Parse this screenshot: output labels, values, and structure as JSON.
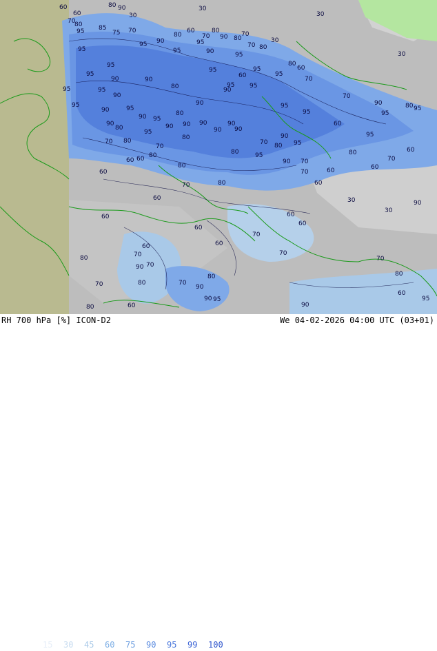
{
  "footer": {
    "left_label": "RH 700 hPa [%] ICON-D2",
    "right_label": "We 04-02-2026 04:00 UTC (03+01)"
  },
  "legend": {
    "values": [
      {
        "label": "15",
        "color": "#e6eef8"
      },
      {
        "label": "30",
        "color": "#c8dcf0"
      },
      {
        "label": "45",
        "color": "#a9c9e8"
      },
      {
        "label": "60",
        "color": "#7fb0e6"
      },
      {
        "label": "75",
        "color": "#6c9ee0"
      },
      {
        "label": "90",
        "color": "#5a8be0"
      },
      {
        "label": "95",
        "color": "#4a78dc"
      },
      {
        "label": "99",
        "color": "#3e66d6"
      },
      {
        "label": "100",
        "color": "#2f55cc"
      }
    ]
  },
  "map": {
    "contour_labels": [
      "60",
      "60",
      "80",
      "90",
      "30",
      "30",
      "30",
      "70",
      "80",
      "95",
      "85",
      "75",
      "70",
      "80",
      "60",
      "70",
      "80",
      "90",
      "80",
      "70",
      "30",
      "95",
      "90",
      "95",
      "95",
      "70",
      "80",
      "30",
      "95",
      "90",
      "95",
      "95",
      "80",
      "60",
      "95",
      "90",
      "90",
      "95",
      "60",
      "95",
      "95",
      "70",
      "95",
      "95",
      "95",
      "80",
      "90",
      "90",
      "95",
      "95",
      "90",
      "95",
      "70",
      "90",
      "80",
      "90",
      "95",
      "95",
      "95",
      "95",
      "90",
      "90",
      "80",
      "95",
      "90",
      "60",
      "80",
      "90",
      "90",
      "90",
      "90",
      "90",
      "95",
      "80",
      "70",
      "80",
      "95",
      "90",
      "70",
      "95",
      "70",
      "80",
      "60",
      "80",
      "80",
      "60",
      "80",
      "95",
      "90",
      "80",
      "60",
      "70",
      "60",
      "70",
      "60",
      "60",
      "70",
      "30",
      "30",
      "90",
      "60",
      "70",
      "60",
      "60",
      "80",
      "60",
      "60",
      "80",
      "70",
      "70",
      "90",
      "70",
      "60",
      "80",
      "60",
      "70",
      "60",
      "80",
      "90",
      "95",
      "90",
      "70",
      "60",
      "80",
      "70",
      "70",
      "80",
      "90",
      "60",
      "95"
    ]
  }
}
